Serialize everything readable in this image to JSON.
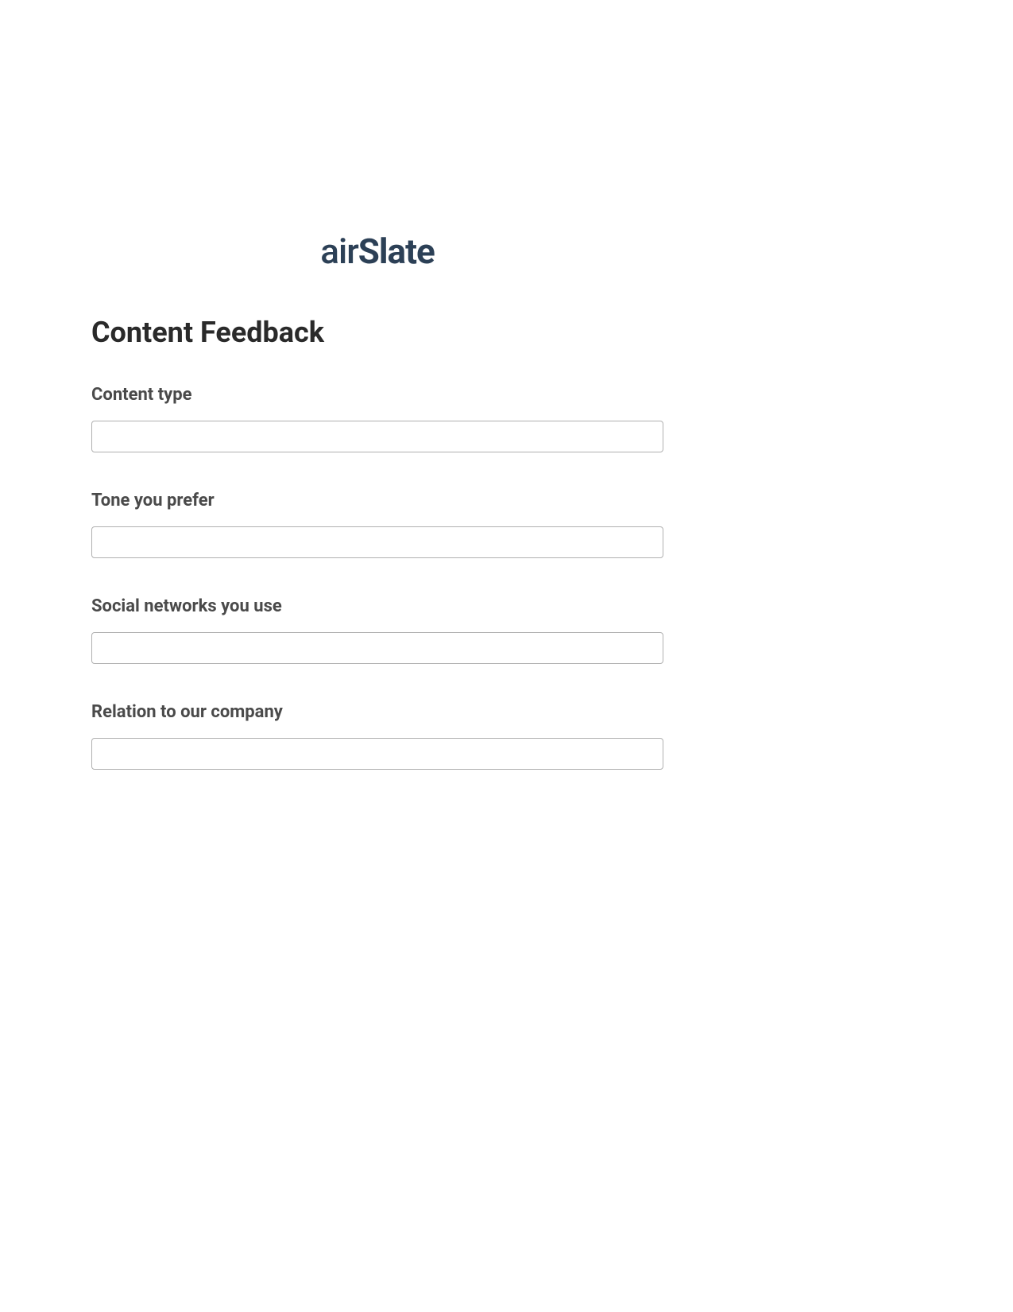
{
  "logo": {
    "part1": "air",
    "part2": "Slate"
  },
  "form": {
    "title": "Content Feedback",
    "fields": [
      {
        "label": "Content type",
        "value": ""
      },
      {
        "label": "Tone you prefer",
        "value": ""
      },
      {
        "label": "Social networks you use",
        "value": ""
      },
      {
        "label": "Relation to our company",
        "value": ""
      }
    ]
  }
}
